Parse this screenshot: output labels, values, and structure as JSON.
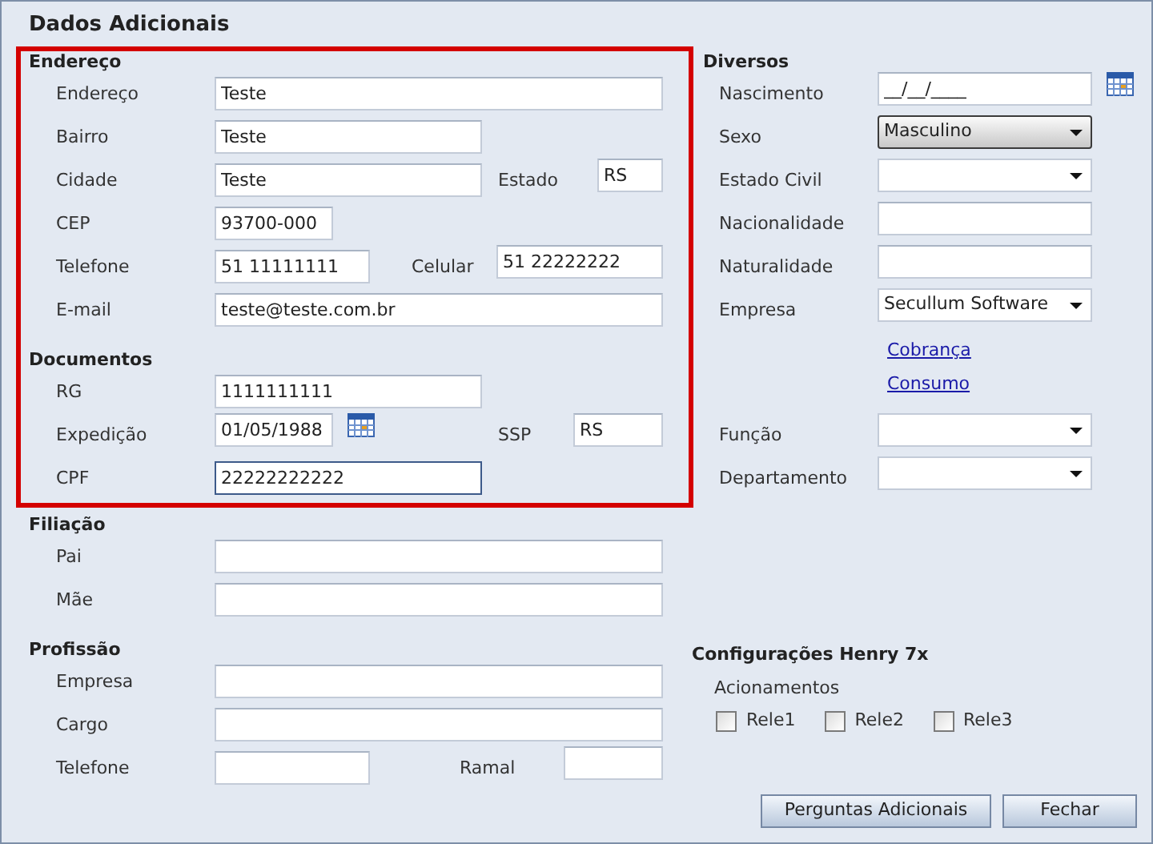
{
  "title": "Dados Adicionais",
  "sections": [
    {
      "heading": "Endereço",
      "highlighted": true,
      "rows": [
        {
          "fields": [
            {
              "label": "Endereço",
              "value": "Teste",
              "kind": "text",
              "focused": false
            }
          ]
        },
        {
          "fields": [
            {
              "label": "Bairro",
              "value": "Teste",
              "kind": "text",
              "focused": false
            }
          ]
        },
        {
          "fields": [
            {
              "label": "Cidade",
              "value": "Teste",
              "kind": "text",
              "focused": false
            },
            {
              "label": "Estado",
              "value": "RS",
              "kind": "text",
              "focused": false
            }
          ]
        },
        {
          "fields": [
            {
              "label": "CEP",
              "value": "93700-000",
              "kind": "text",
              "focused": false
            }
          ]
        },
        {
          "fields": [
            {
              "label": "Telefone",
              "value": "51 11111111",
              "kind": "text",
              "focused": false
            },
            {
              "label": "Celular",
              "value": "51 22222222",
              "kind": "text",
              "focused": false
            }
          ]
        },
        {
          "fields": [
            {
              "label": "E-mail",
              "value": "teste@teste.com.br",
              "kind": "text",
              "focused": false
            }
          ]
        }
      ]
    },
    {
      "heading": "Documentos",
      "highlighted": true,
      "rows": [
        {
          "fields": [
            {
              "label": "RG",
              "value": "1111111111",
              "kind": "text",
              "focused": false
            }
          ]
        },
        {
          "fields": [
            {
              "label": "Expedição",
              "value": "01/05/1988",
              "kind": "date",
              "focused": false
            },
            {
              "label": "SSP",
              "value": "RS",
              "kind": "text",
              "focused": false
            }
          ]
        },
        {
          "fields": [
            {
              "label": "CPF",
              "value": "22222222222",
              "kind": "text",
              "focused": true
            }
          ]
        }
      ]
    },
    {
      "heading": "Filiação",
      "highlighted": false,
      "rows": [
        {
          "fields": [
            {
              "label": "Pai",
              "kind": "text",
              "focused": false
            }
          ]
        },
        {
          "fields": [
            {
              "label": "Mãe",
              "kind": "text",
              "focused": false
            }
          ]
        }
      ]
    },
    {
      "heading": "Profissão",
      "highlighted": false,
      "rows": [
        {
          "fields": [
            {
              "label": "Empresa",
              "kind": "text",
              "focused": false
            }
          ]
        },
        {
          "fields": [
            {
              "label": "Cargo",
              "kind": "text",
              "focused": false
            }
          ]
        },
        {
          "fields": [
            {
              "label": "Telefone",
              "kind": "text",
              "focused": false
            },
            {
              "label": "Ramal",
              "kind": "text",
              "focused": false
            }
          ]
        }
      ]
    }
  ],
  "diversos": {
    "heading": "Diversos",
    "rows": [
      {
        "label": "Nascimento",
        "value": "__/__/____",
        "kind": "date",
        "focused": false
      },
      {
        "label": "Sexo",
        "value": "Masculino",
        "kind": "select",
        "focused": true
      },
      {
        "label": "Estado Civil",
        "kind": "select",
        "focused": false
      },
      {
        "label": "Nacionalidade",
        "kind": "text",
        "focused": false
      },
      {
        "label": "Naturalidade",
        "kind": "text",
        "focused": false
      },
      {
        "label": "Empresa",
        "value": "Secullum Software",
        "kind": "select",
        "focused": false
      }
    ],
    "links": [
      "Cobrança",
      "Consumo"
    ],
    "rows_2": [
      {
        "label": "Função",
        "kind": "select",
        "focused": false
      },
      {
        "label": "Departamento",
        "kind": "select",
        "focused": false
      }
    ]
  },
  "henry": {
    "heading": "Configurações Henry 7x",
    "subheading": "Acionamentos",
    "checkboxes": [
      {
        "label": "Rele1",
        "checked": false
      },
      {
        "label": "Rele2",
        "checked": false
      },
      {
        "label": "Rele3",
        "checked": false
      }
    ]
  },
  "buttons": [
    "Perguntas Adicionais",
    "Fechar"
  ]
}
